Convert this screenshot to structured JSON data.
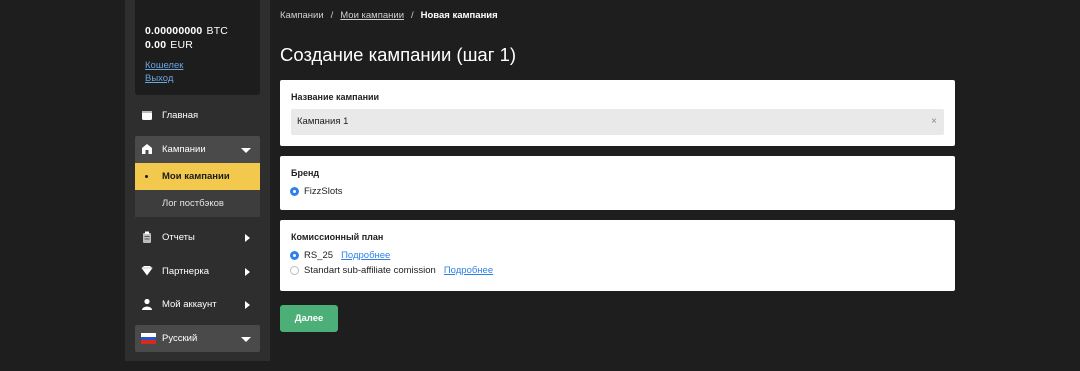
{
  "balance": {
    "btc_amount": "0.00000000",
    "btc_currency": "BTC",
    "eur_amount": "0.00",
    "eur_currency": "EUR",
    "wallet_link": "Кошелек",
    "exit_link": "Выход"
  },
  "sidebar": {
    "home": "Главная",
    "campaigns": "Кампании",
    "my_campaigns": "Мои кампании",
    "postback_log": "Лог постбэков",
    "reports": "Отчеты",
    "partner": "Партнерка",
    "my_account": "Мой аккаунт",
    "language": "Русский"
  },
  "breadcrumb": {
    "item1": "Кампании",
    "sep": "/",
    "item2": "Мои кампании",
    "current": "Новая кампания"
  },
  "page": {
    "title": "Создание кампании (шаг 1)"
  },
  "form": {
    "name_label": "Название кампании",
    "name_value": "Кампания 1",
    "clear_symbol": "×",
    "brand_label": "Бренд",
    "brand_option": "FizzSlots",
    "plan_label": "Комиссионный план",
    "plan_options": [
      {
        "label": "RS_25",
        "link": "Подробнее",
        "selected": true
      },
      {
        "label": "Standart sub-affiliate comission",
        "link": "Подробнее",
        "selected": false
      }
    ],
    "next_button": "Далее"
  },
  "colors": {
    "accent_yellow": "#f2c94c",
    "button_green": "#4caf78",
    "link_blue": "#2f80ed"
  }
}
